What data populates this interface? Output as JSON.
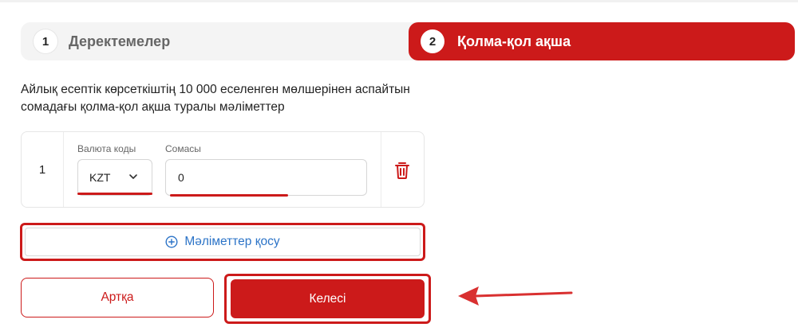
{
  "stepper": {
    "steps": [
      {
        "number": "1",
        "label": "Деректемелер",
        "active": false
      },
      {
        "number": "2",
        "label": "Қолма-қол ақша",
        "active": true
      }
    ]
  },
  "description": "Айлық есептік көрсеткіштің 10 000 еселенген мөлшерінен аспайтын сомадағы қолма-қол ақша туралы мәліметтер",
  "items": [
    {
      "index": "1",
      "currency_label": "Валюта коды",
      "currency_value": "KZT",
      "amount_label": "Сомасы",
      "amount_value": "0"
    }
  ],
  "add_button_label": "Мәліметтер қосу",
  "back_button_label": "Артқа",
  "next_button_label": "Келесі",
  "colors": {
    "accent": "#cc1a1a",
    "link": "#2b73c7",
    "stepper_bg": "#f4f4f4"
  },
  "icons": [
    "chevron-down-icon",
    "trash-icon",
    "plus-circle-icon",
    "arrow-left-icon"
  ]
}
